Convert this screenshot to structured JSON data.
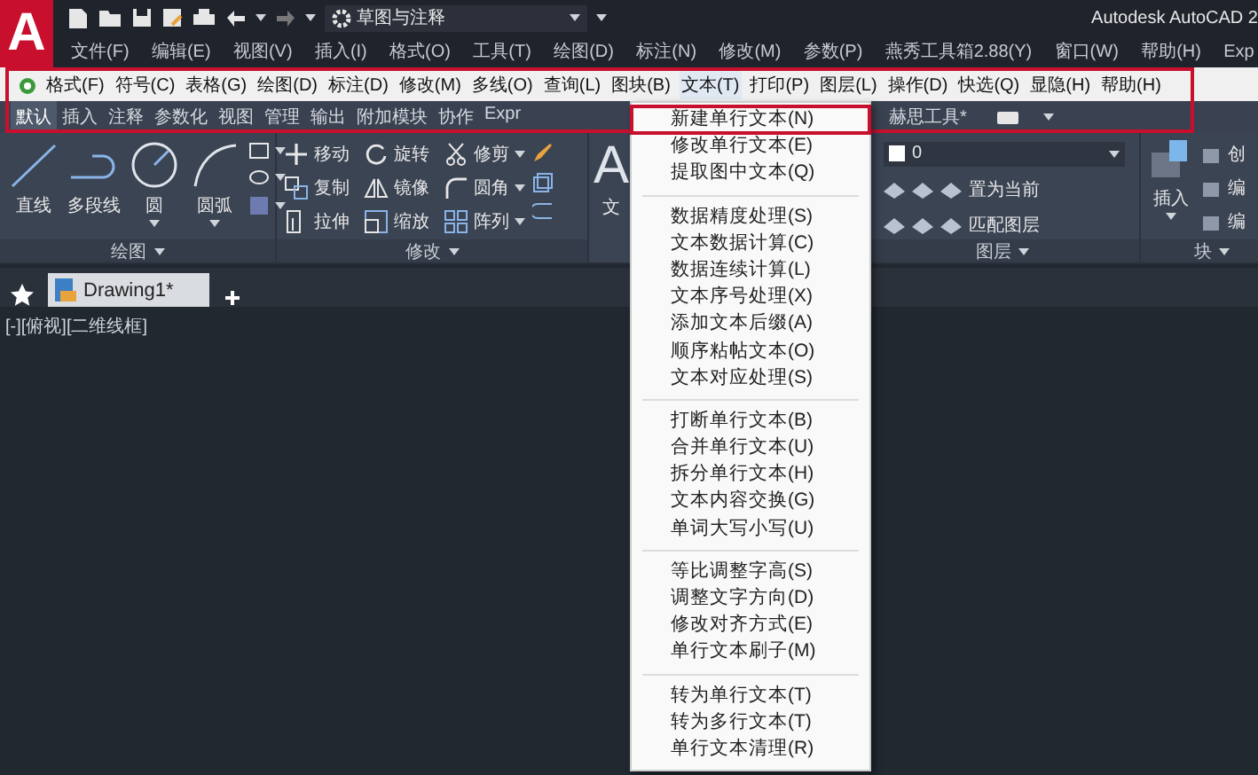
{
  "title_bar": {
    "logo": "A",
    "workspace": "草图与注释",
    "title": "Autodesk AutoCAD 2"
  },
  "menu_bar": [
    "文件(F)",
    "编辑(E)",
    "视图(V)",
    "插入(I)",
    "格式(O)",
    "工具(T)",
    "绘图(D)",
    "标注(N)",
    "修改(M)",
    "参数(P)",
    "燕秀工具箱2.88(Y)",
    "窗口(W)",
    "帮助(H)",
    "Exp"
  ],
  "custom_menu_bar": [
    {
      "label": "格式(F)",
      "selected": false
    },
    {
      "label": "符号(C)",
      "selected": false
    },
    {
      "label": "表格(G)",
      "selected": false
    },
    {
      "label": "绘图(D)",
      "selected": false
    },
    {
      "label": "标注(D)",
      "selected": false
    },
    {
      "label": "修改(M)",
      "selected": false
    },
    {
      "label": "多线(O)",
      "selected": false
    },
    {
      "label": "查询(L)",
      "selected": false
    },
    {
      "label": "图块(B)",
      "selected": false
    },
    {
      "label": "文本(T)",
      "selected": true
    },
    {
      "label": "打印(P)",
      "selected": false
    },
    {
      "label": "图层(L)",
      "selected": false
    },
    {
      "label": "操作(D)",
      "selected": false
    },
    {
      "label": "快选(Q)",
      "selected": false
    },
    {
      "label": "显隐(H)",
      "selected": false
    },
    {
      "label": "帮助(H)",
      "selected": false
    }
  ],
  "ribbon_tabs": [
    {
      "label": "默认",
      "selected": true
    },
    {
      "label": "插入",
      "selected": false
    },
    {
      "label": "注释",
      "selected": false
    },
    {
      "label": "参数化",
      "selected": false
    },
    {
      "label": "视图",
      "selected": false
    },
    {
      "label": "管理",
      "selected": false
    },
    {
      "label": "输出",
      "selected": false
    },
    {
      "label": "附加模块",
      "selected": false
    },
    {
      "label": "协作",
      "selected": false
    },
    {
      "label": "Expr",
      "selected": false
    },
    {
      "label": "赫思工具*",
      "selected": false
    }
  ],
  "ribbon": {
    "draw_panel": {
      "tools": [
        "直线",
        "多段线",
        "圆",
        "圆弧"
      ],
      "label": "绘图"
    },
    "modify_panel": {
      "tools": [
        "移动",
        "旋转",
        "修剪",
        "复制",
        "镜像",
        "圆角",
        "拉伸",
        "缩放",
        "阵列"
      ],
      "label": "修改"
    },
    "annotation_panel": {
      "icon_letter": "A",
      "label": "文"
    },
    "layers_panel": {
      "layer": "0",
      "actions": [
        "置为当前",
        "匹配图层"
      ],
      "label": "图层"
    },
    "block_panel": {
      "insert": "插入",
      "actions": [
        "创",
        "编",
        "编"
      ],
      "label": "块"
    }
  },
  "file_tabs": [
    {
      "label": "Drawing1*",
      "selected": true
    }
  ],
  "viewport": {
    "label": "[-][俯视][二维线框]"
  },
  "text_menu": {
    "groups": [
      [
        {
          "label": "新建单行文本(N)",
          "selected": true
        },
        {
          "label": "修改单行文本(E)",
          "selected": false
        },
        {
          "label": "提取图中文本(Q)",
          "selected": false
        }
      ],
      [
        {
          "label": "数据精度处理(S)",
          "selected": false
        },
        {
          "label": "文本数据计算(C)",
          "selected": false
        },
        {
          "label": "数据连续计算(L)",
          "selected": false
        },
        {
          "label": "文本序号处理(X)",
          "selected": false
        },
        {
          "label": "添加文本后缀(A)",
          "selected": false
        },
        {
          "label": "顺序粘帖文本(O)",
          "selected": false
        },
        {
          "label": "文本对应处理(S)",
          "selected": false
        }
      ],
      [
        {
          "label": "打断单行文本(B)",
          "selected": false
        },
        {
          "label": "合并单行文本(U)",
          "selected": false
        },
        {
          "label": "拆分单行文本(H)",
          "selected": false
        },
        {
          "label": "文本内容交换(G)",
          "selected": false
        },
        {
          "label": "单词大写小写(U)",
          "selected": false
        }
      ],
      [
        {
          "label": "等比调整字高(S)",
          "selected": false
        },
        {
          "label": "调整文字方向(D)",
          "selected": false
        },
        {
          "label": "修改对齐方式(E)",
          "selected": false
        },
        {
          "label": "单行文本刷子(M)",
          "selected": false
        }
      ],
      [
        {
          "label": "转为单行文本(T)",
          "selected": false
        },
        {
          "label": "转为多行文本(T)",
          "selected": false
        },
        {
          "label": "单行文本清理(R)",
          "selected": false
        }
      ]
    ]
  }
}
